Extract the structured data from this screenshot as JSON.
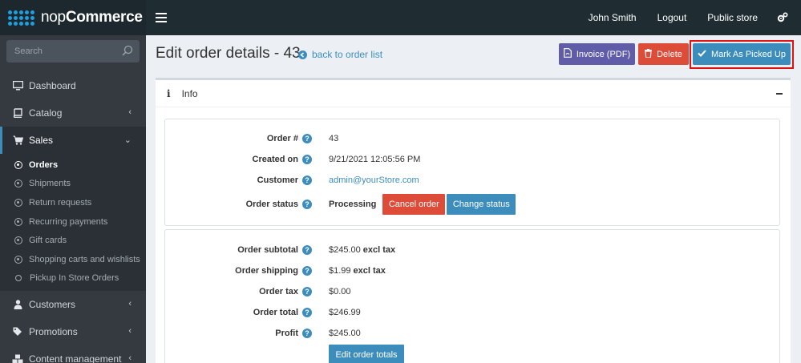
{
  "header": {
    "logo_text_light": "nop",
    "logo_text_bold": "Commerce",
    "user": "John Smith",
    "logout": "Logout",
    "public_store": "Public store"
  },
  "sidebar": {
    "search_placeholder": "Search",
    "items": [
      {
        "label": "Dashboard",
        "icon": "monitor-icon"
      },
      {
        "label": "Catalog",
        "icon": "book-icon"
      },
      {
        "label": "Sales",
        "icon": "cart-icon"
      },
      {
        "label": "Customers",
        "icon": "user-icon"
      },
      {
        "label": "Promotions",
        "icon": "tags-icon"
      },
      {
        "label": "Content management",
        "icon": "cubes-icon"
      }
    ],
    "sales_sub": [
      "Orders",
      "Shipments",
      "Return requests",
      "Recurring payments",
      "Gift cards",
      "Shopping carts and wishlists",
      "Pickup In Store Orders"
    ]
  },
  "page": {
    "title": "Edit order details - 43",
    "back_link": "back to order list",
    "invoice_btn": "Invoice (PDF)",
    "delete_btn": "Delete",
    "pickup_btn": "Mark As Picked Up",
    "card_title": "Info"
  },
  "order": {
    "number_label": "Order #",
    "number": "43",
    "created_label": "Created on",
    "created": "9/21/2021 12:05:56 PM",
    "customer_label": "Customer",
    "customer": "admin@yourStore.com",
    "status_label": "Order status",
    "status": "Processing",
    "cancel_btn": "Cancel order",
    "change_status_btn": "Change status"
  },
  "totals": {
    "subtotal_label": "Order subtotal",
    "subtotal": "$245.00",
    "subtotal_suffix": "excl tax",
    "shipping_label": "Order shipping",
    "shipping": "$1.99",
    "shipping_suffix": "excl tax",
    "tax_label": "Order tax",
    "tax": "$0.00",
    "total_label": "Order total",
    "total": "$246.99",
    "profit_label": "Profit",
    "profit": "$245.00",
    "edit_btn": "Edit order totals"
  }
}
